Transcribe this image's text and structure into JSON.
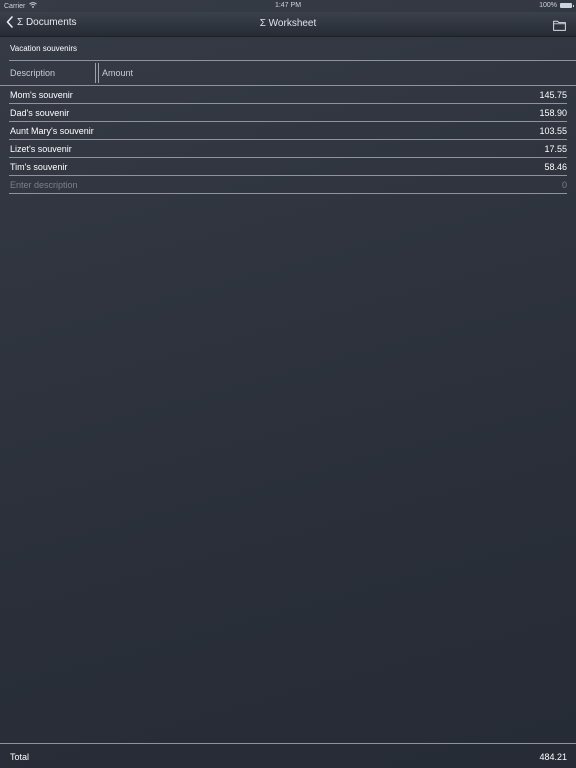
{
  "status_bar": {
    "carrier": "Carrier",
    "time": "1:47 PM",
    "battery": "100%",
    "battery_level": 1.0
  },
  "navbar": {
    "back_label": "Σ Documents",
    "title": "Σ Worksheet",
    "right_icon": "folder-icon"
  },
  "sheet": {
    "title": "Vacation souvenirs",
    "columns": {
      "description": "Description",
      "amount": "Amount"
    },
    "rows": [
      {
        "description": "Mom's souvenir",
        "amount": "145.75"
      },
      {
        "description": "Dad's souvenir",
        "amount": "158.90"
      },
      {
        "description": "Aunt Mary's souvenir",
        "amount": "103.55"
      },
      {
        "description": "Lizet's souvenir",
        "amount": "17.55"
      },
      {
        "description": "Tim's souvenir",
        "amount": "58.46"
      }
    ],
    "entry": {
      "placeholder": "Enter description",
      "amount": "0"
    }
  },
  "footer": {
    "total_label": "Total",
    "total_value": "484.21"
  },
  "colors": {
    "background": "#2f343e",
    "navbar": "#30353f",
    "text": "#ffffff",
    "placeholder": "#7b808a",
    "rule": "#8f949c"
  }
}
